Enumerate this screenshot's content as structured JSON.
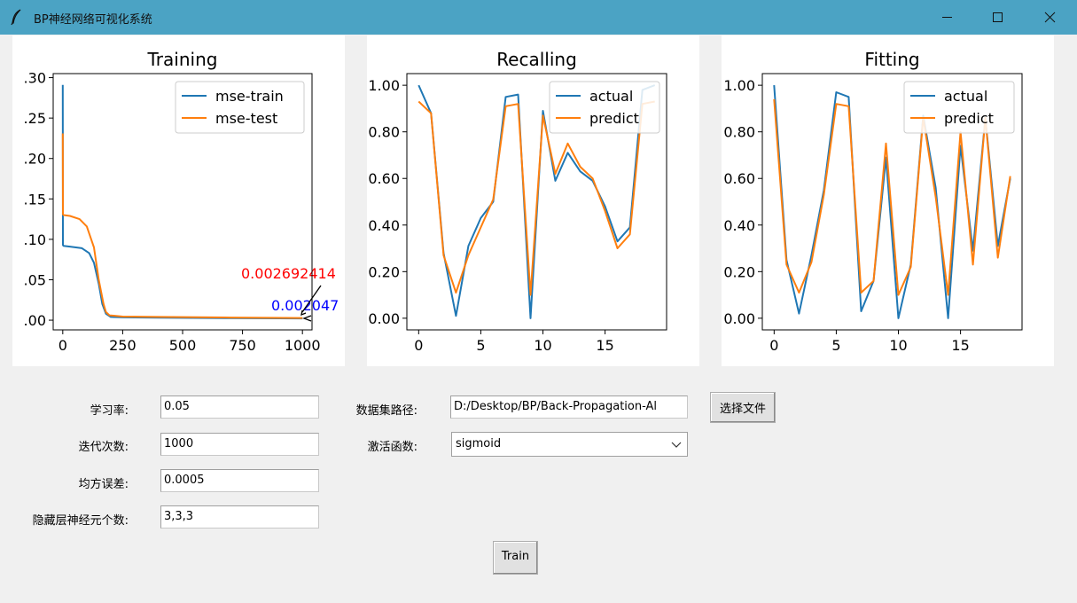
{
  "window": {
    "title": "BP神经网络可视化系统"
  },
  "colors": {
    "train": "#1f77b4",
    "test": "#ff7f0e",
    "ann_red": "#ff0000",
    "ann_blue": "#0000ff",
    "titlebar": "#4ba3c4"
  },
  "icons": {
    "app": "feather-icon",
    "minimize": "minimize-icon",
    "maximize": "maximize-icon",
    "close": "close-icon",
    "dropdown": "chevron-down-icon"
  },
  "chart_data": [
    {
      "type": "line",
      "title": "Training",
      "xlim": [
        -40,
        1040
      ],
      "ylim": [
        -0.012,
        0.305
      ],
      "xticks": [
        0,
        250,
        500,
        750,
        1000
      ],
      "xtick_labels": [
        "0",
        "250",
        "500",
        "750",
        "1000"
      ],
      "yticks": [
        0,
        0.05,
        0.1,
        0.15,
        0.2,
        0.25,
        0.3
      ],
      "ytick_labels": [
        ".00",
        ".05",
        ".10",
        ".15",
        ".20",
        ".25",
        ".30"
      ],
      "legend": "top-right",
      "series": [
        {
          "name": "mse-train",
          "x": [
            0,
            0.5,
            3,
            30,
            80,
            110,
            130,
            150,
            165,
            180,
            200,
            250,
            400,
            700,
            1000
          ],
          "y": [
            0.291,
            0.093,
            0.092,
            0.091,
            0.089,
            0.083,
            0.071,
            0.045,
            0.02,
            0.008,
            0.004,
            0.0035,
            0.003,
            0.0025,
            0.0021
          ]
        },
        {
          "name": "mse-test",
          "x": [
            0,
            0.5,
            3,
            30,
            70,
            100,
            130,
            150,
            170,
            180,
            195,
            250,
            400,
            700,
            1000
          ],
          "y": [
            0.231,
            0.131,
            0.13,
            0.129,
            0.125,
            0.116,
            0.09,
            0.05,
            0.02,
            0.01,
            0.006,
            0.0045,
            0.004,
            0.0032,
            0.0027
          ]
        }
      ],
      "annotations": [
        {
          "text": "0.002692414",
          "color": "red"
        },
        {
          "text": "0.002047",
          "color": "blue"
        }
      ]
    },
    {
      "type": "line",
      "title": "Recalling",
      "xlim": [
        -0.95,
        19.95
      ],
      "ylim": [
        -0.05,
        1.05
      ],
      "xticks": [
        0,
        5,
        10,
        15
      ],
      "xtick_labels": [
        "0",
        "5",
        "10",
        "15"
      ],
      "yticks": [
        0,
        0.2,
        0.4,
        0.6,
        0.8,
        1.0
      ],
      "ytick_labels": [
        "0.00",
        "0.20",
        "0.40",
        "0.60",
        "0.80",
        "1.00"
      ],
      "legend": "top-right",
      "series": [
        {
          "name": "actual",
          "x": [
            0,
            1,
            2,
            3,
            4,
            5,
            6,
            7,
            8,
            9,
            10,
            11,
            12,
            13,
            14,
            15,
            16,
            17,
            18,
            19
          ],
          "y": [
            1.0,
            0.88,
            0.28,
            0.01,
            0.31,
            0.43,
            0.5,
            0.95,
            0.96,
            0.0,
            0.89,
            0.59,
            0.71,
            0.63,
            0.59,
            0.48,
            0.33,
            0.39,
            0.98,
            1.0
          ]
        },
        {
          "name": "predict",
          "x": [
            0,
            1,
            2,
            3,
            4,
            5,
            6,
            7,
            8,
            9,
            10,
            11,
            12,
            13,
            14,
            15,
            16,
            17,
            18,
            19
          ],
          "y": [
            0.93,
            0.88,
            0.27,
            0.11,
            0.27,
            0.39,
            0.51,
            0.91,
            0.92,
            0.1,
            0.87,
            0.62,
            0.75,
            0.65,
            0.6,
            0.46,
            0.3,
            0.36,
            0.92,
            0.93
          ]
        }
      ]
    },
    {
      "type": "line",
      "title": "Fitting",
      "xlim": [
        -0.95,
        19.95
      ],
      "ylim": [
        -0.05,
        1.05
      ],
      "xticks": [
        0,
        5,
        10,
        15
      ],
      "xtick_labels": [
        "0",
        "5",
        "10",
        "15"
      ],
      "yticks": [
        0,
        0.2,
        0.4,
        0.6,
        0.8,
        1.0
      ],
      "ytick_labels": [
        "0.00",
        "0.20",
        "0.40",
        "0.60",
        "0.80",
        "1.00"
      ],
      "legend": "top-right",
      "series": [
        {
          "name": "actual",
          "x": [
            0,
            1,
            2,
            3,
            4,
            5,
            6,
            7,
            8,
            9,
            10,
            11,
            12,
            13,
            14,
            15,
            16,
            17,
            18,
            19
          ],
          "y": [
            1.0,
            0.25,
            0.02,
            0.27,
            0.55,
            0.97,
            0.95,
            0.03,
            0.16,
            0.69,
            0.0,
            0.23,
            0.87,
            0.56,
            0.0,
            0.74,
            0.29,
            0.86,
            0.31,
            0.6
          ]
        },
        {
          "name": "predict",
          "x": [
            0,
            1,
            2,
            3,
            4,
            5,
            6,
            7,
            8,
            9,
            10,
            11,
            12,
            13,
            14,
            15,
            16,
            17,
            18,
            19
          ],
          "y": [
            0.94,
            0.23,
            0.11,
            0.24,
            0.53,
            0.92,
            0.91,
            0.11,
            0.16,
            0.75,
            0.1,
            0.22,
            0.86,
            0.52,
            0.1,
            0.8,
            0.23,
            0.86,
            0.26,
            0.61
          ]
        }
      ]
    }
  ],
  "form": {
    "learning_rate": {
      "label": "学习率:",
      "value": "0.05"
    },
    "iterations": {
      "label": "迭代次数:",
      "value": "1000"
    },
    "mse_target": {
      "label": "均方误差:",
      "value": "0.0005"
    },
    "hidden_neurons": {
      "label": "隐藏层神经元个数:",
      "value": "3,3,3"
    },
    "dataset_path": {
      "label": "数据集路径:",
      "value": "D:/Desktop/BP/Back-Propagation-Al"
    },
    "choose_file_button": "选择文件",
    "activation": {
      "label": "激活函数:",
      "value": "sigmoid"
    },
    "train_button": "Train"
  }
}
